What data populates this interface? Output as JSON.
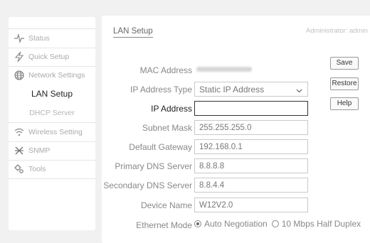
{
  "sidebar": {
    "items": [
      {
        "label": "Status",
        "icon": "pulse-icon"
      },
      {
        "label": "Quick Setup",
        "icon": "lightning-icon"
      },
      {
        "label": "Network Settings",
        "icon": "globe-icon"
      },
      {
        "label": "LAN Setup"
      },
      {
        "label": "DHCP Server"
      },
      {
        "label": "Wireless Setting",
        "icon": "wifi-icon"
      },
      {
        "label": "SNMP",
        "icon": "snmp-icon"
      },
      {
        "label": "Tools",
        "icon": "tools-icon"
      }
    ]
  },
  "main": {
    "title": "LAN Setup",
    "admin": "Administrator: admin",
    "fields": {
      "mac_label": "MAC Address",
      "ip_type_label": "IP Address Type",
      "ip_type_value": "Static IP Address",
      "ip_label": "IP Address",
      "ip_value": "",
      "subnet_label": "Subnet Mask",
      "subnet_value": "255.255.255.0",
      "gateway_label": "Default Gateway",
      "gateway_value": "192.168.0.1",
      "dns1_label": "Primary DNS Server",
      "dns1_value": "8.8.8.8",
      "dns2_label": "Secondary DNS Server",
      "dns2_value": "8.8.4.4",
      "device_label": "Device Name",
      "device_value": "W12V2.0",
      "eth_label": "Ethernet Mode",
      "eth_opt1": "Auto Negotiation",
      "eth_opt2": "10 Mbps Half Duplex"
    },
    "buttons": {
      "save": "Save",
      "restore": "Restore",
      "help": "Help"
    }
  }
}
